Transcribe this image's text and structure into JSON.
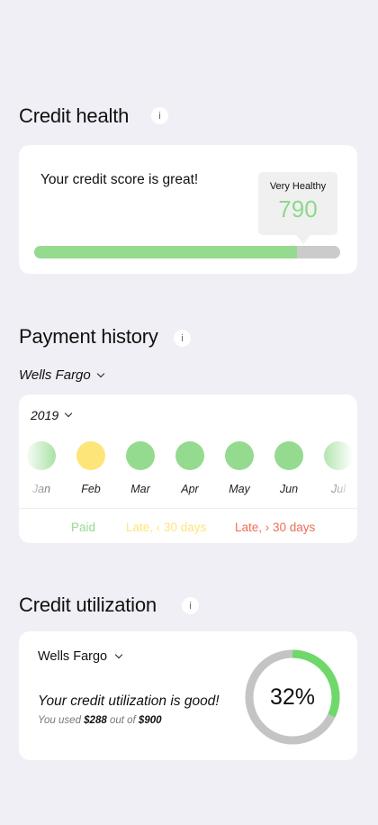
{
  "credit_health": {
    "title": "Credit health",
    "info_label": "i",
    "message": "Your credit score is great!",
    "score_status": "Very Healthy",
    "score_value": "790",
    "bar_fraction": 0.86
  },
  "payment_history": {
    "title": "Payment history",
    "info_label": "i",
    "bank": "Wells Fargo",
    "year": "2019",
    "months": [
      {
        "label": "Jan",
        "status": "paid"
      },
      {
        "label": "Feb",
        "status": "late30"
      },
      {
        "label": "Mar",
        "status": "paid"
      },
      {
        "label": "Apr",
        "status": "paid"
      },
      {
        "label": "May",
        "status": "paid"
      },
      {
        "label": "Jun",
        "status": "paid"
      },
      {
        "label": "Jul",
        "status": "paid"
      }
    ],
    "legend": {
      "paid": "Paid",
      "late_under": "Late, ‹ 30 days",
      "late_over": "Late, › 30 days"
    },
    "colors": {
      "paid": "#95db8f",
      "late_under": "#fde57a",
      "late_over": "#f06d58"
    }
  },
  "utilization": {
    "title": "Credit utilization",
    "info_label": "i",
    "bank": "Wells Fargo",
    "message": "Your credit utilization is good!",
    "sub_prefix": "You used ",
    "used": "$288",
    "sub_mid": " out of ",
    "total": "$900",
    "percent_label": "32%",
    "fraction": 0.32,
    "colors": {
      "used": "#6fd86a",
      "rest": "#c4c4c4"
    }
  }
}
